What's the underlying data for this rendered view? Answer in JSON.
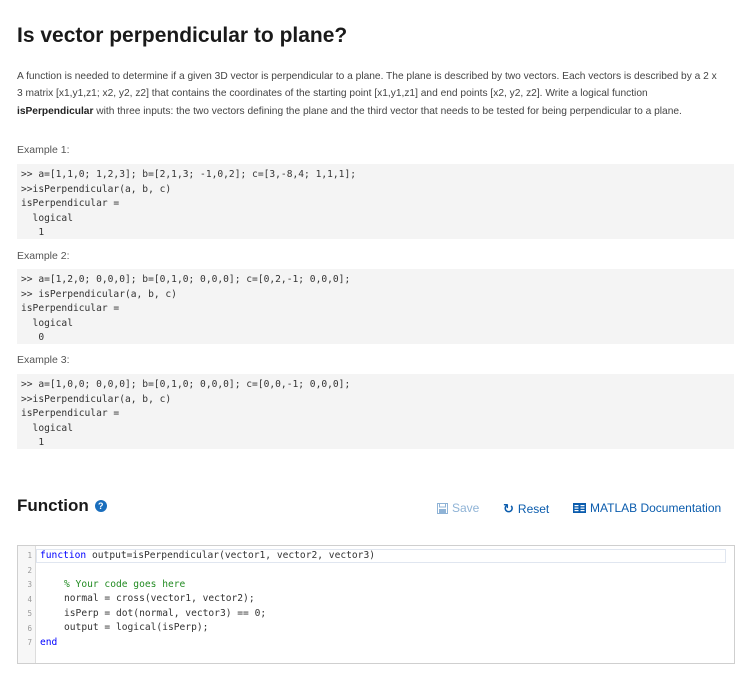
{
  "problem": {
    "title": "Is vector perpendicular to plane?",
    "desc_part1": "A function is needed to determine if a given 3D vector is perpendicular to a plane.  The plane is described by two vectors. Each vectors is described by a 2 x 3 matrix [x1,y1,z1; x2, y2, z2] that contains the coordinates of the starting point [x1,y1,z1] and end points [x2, y2, z2]. Write a logical function ",
    "desc_bold": "isPerpendicular",
    "desc_part2": " with three inputs: the two vectors defining the plane and the third vector that needs to be tested for being perpendicular to a plane.",
    "examples": [
      {
        "label": "Example 1:",
        "code": ">> a=[1,1,0; 1,2,3]; b=[2,1,3; -1,0,2]; c=[3,-8,4; 1,1,1];\n>>isPerpendicular(a, b, c)\nisPerpendicular =\n  logical\n   1"
      },
      {
        "label": "Example 2:",
        "code": ">> a=[1,2,0; 0,0,0]; b=[0,1,0; 0,0,0]; c=[0,2,-1; 0,0,0];\n>> isPerpendicular(a, b, c)\nisPerpendicular =\n  logical\n   0"
      },
      {
        "label": "Example 3:",
        "code": ">> a=[1,0,0; 0,0,0]; b=[0,1,0; 0,0,0]; c=[0,0,-1; 0,0,0];\n>>isPerpendicular(a, b, c)\nisPerpendicular =\n  logical\n   1"
      }
    ]
  },
  "function_section": {
    "heading": "Function",
    "help_icon": "question-circle-icon",
    "save_label": "Save",
    "reset_label": "Reset",
    "docs_label": "MATLAB Documentation",
    "colors": {
      "link": "#0b5cad",
      "disabled": "#8fb3d6",
      "keyword": "#0000ff",
      "comment": "#228b22"
    }
  },
  "editor": {
    "line_numbers": [
      "1",
      "2",
      "3",
      "4",
      "5",
      "6",
      "7"
    ],
    "lines": {
      "l1_kw": "function",
      "l1_rest": " output=isPerpendicular(vector1, vector2, vector3)",
      "l2": "",
      "l3_comment": "% Your code goes here",
      "l4": "normal = cross(vector1, vector2);",
      "l5": "isPerp = dot(normal, vector3) == 0;",
      "l6": "output = logical(isPerp);",
      "l7_kw": "end"
    }
  }
}
